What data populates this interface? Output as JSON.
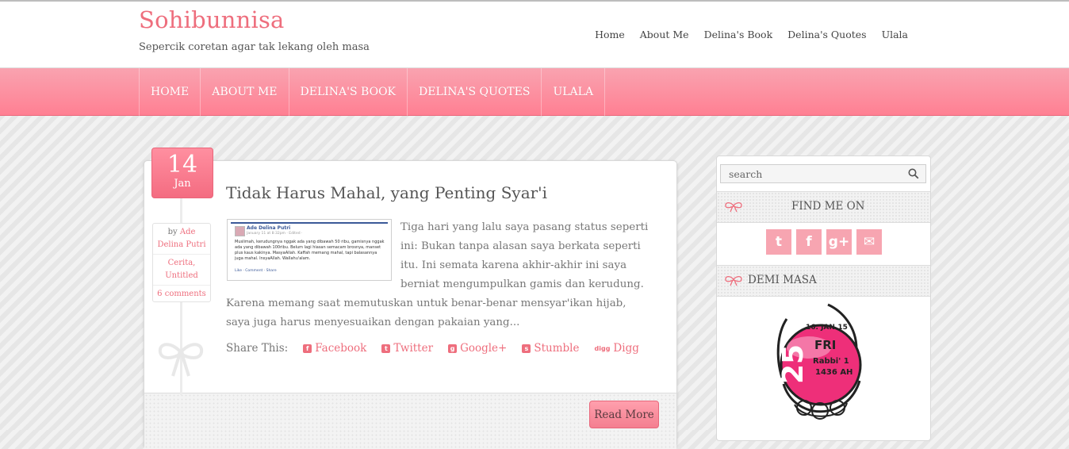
{
  "site": {
    "title": "Sohibunnisa",
    "tagline": "Sepercik coretan agar tak lekang oleh masa"
  },
  "top_nav": [
    "Home",
    "About Me",
    "Delina's Book",
    "Delina's Quotes",
    "Ulala"
  ],
  "main_nav": [
    "Home",
    "About Me",
    "Delina's Book",
    "Delina's Quotes",
    "Ulala"
  ],
  "post": {
    "date_day": "14",
    "date_month": "Jan",
    "title": "Tidak Harus Mahal, yang Penting Syar'i",
    "author_prefix": "by",
    "author": "Ade Delina Putri",
    "categories": "Cerita, Untitled",
    "comments": "6 comments",
    "excerpt": "Tiga hari yang lalu saya pasang status seperti ini: Bukan tanpa alasan saya berkata seperti itu. Ini semata karena akhir-akhir ini saya berniat mengumpulkan gamis dan kerudung. Karena memang saat memutuskan untuk benar-benar mensyar'ikan hijab, saya juga harus menyesuaikan dengan pakaian yang...",
    "thumbnail": {
      "name": "Ade Delina Putri",
      "meta": "January 11 at 8:32pm · Edited · ",
      "text": "Muslimah, kerudungnya nggak ada yang dibawah 50 ribu, gamisnya nggak ada yang dibawah 100ribu. Belum lagi hiasan semacam brosnya, manset plus kaus kakinya. MasyaAllah. Kaffah memang mahal, tapi balasannya juga mahal. InsyaAllah. Wallahu'alam.",
      "links": "Like · Comment · Share"
    },
    "share_label": "Share This:",
    "share": [
      {
        "label": "Facebook",
        "icon": "facebook-icon",
        "glyph": "f"
      },
      {
        "label": "Twitter",
        "icon": "twitter-icon",
        "glyph": "t"
      },
      {
        "label": "Google+",
        "icon": "google-plus-icon",
        "glyph": "g"
      },
      {
        "label": "Stumble",
        "icon": "stumbleupon-icon",
        "glyph": "s"
      },
      {
        "label": "Digg",
        "icon": "digg-icon",
        "glyph": "digg"
      }
    ],
    "read_more": "Read More"
  },
  "sidebar": {
    "search_placeholder": "search",
    "find_me_title": "Find me on",
    "social": [
      {
        "icon": "twitter-icon",
        "glyph": "t"
      },
      {
        "icon": "facebook-icon",
        "glyph": "f"
      },
      {
        "icon": "google-plus-icon",
        "glyph": "g+"
      },
      {
        "icon": "email-icon",
        "glyph": "✉"
      }
    ],
    "demi_masa_title": "Demi Masa",
    "calendar": {
      "gregorian": "16. JAN.15",
      "hijri_day": "25",
      "weekday": "FRI",
      "hijri_month": "Rabbi' 1",
      "hijri_year": "1436 AH"
    }
  },
  "colors": {
    "accent": "#ee6e7d",
    "nav_top": "#f9a3b0",
    "nav_bottom": "#ff7f92"
  }
}
